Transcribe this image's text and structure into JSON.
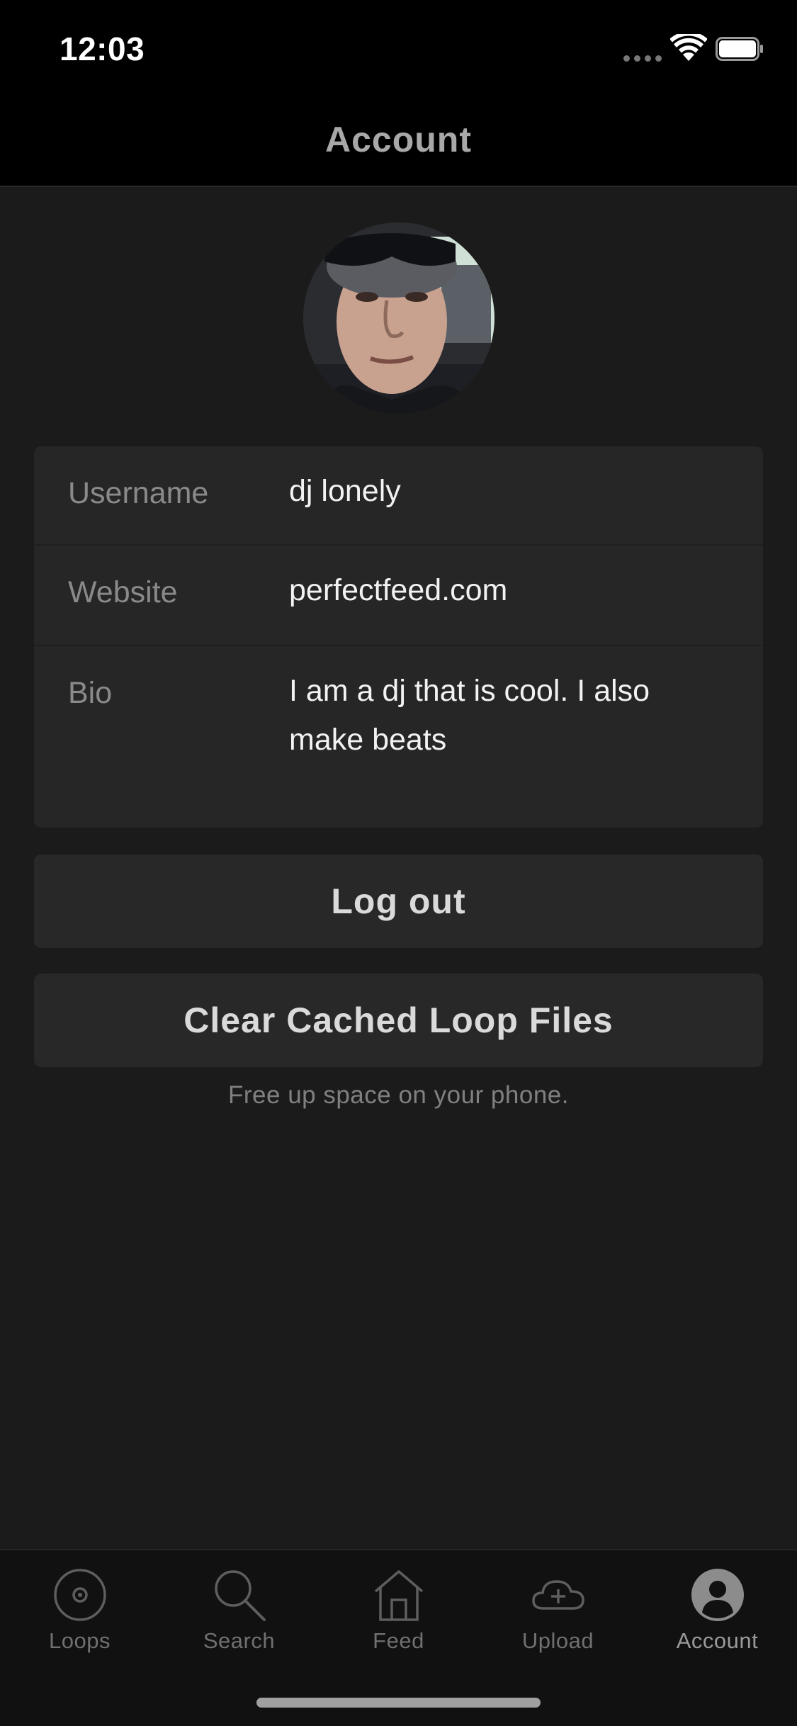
{
  "status_bar": {
    "time": "12:03"
  },
  "nav": {
    "title": "Account"
  },
  "profile": {
    "fields": [
      {
        "label": "Username",
        "value": "dj lonely"
      },
      {
        "label": "Website",
        "value": "perfectfeed.com"
      },
      {
        "label": "Bio",
        "value": "I am a dj that is cool. I also make beats"
      }
    ]
  },
  "actions": {
    "logout_label": "Log out",
    "clear_cache_label": "Clear Cached Loop Files",
    "clear_cache_hint": "Free up space on your phone."
  },
  "tabs": [
    {
      "label": "Loops",
      "icon": "loops-icon",
      "active": false
    },
    {
      "label": "Search",
      "icon": "search-icon",
      "active": false
    },
    {
      "label": "Feed",
      "icon": "home-icon",
      "active": false
    },
    {
      "label": "Upload",
      "icon": "cloud-upload-icon",
      "active": false
    },
    {
      "label": "Account",
      "icon": "account-icon",
      "active": true
    }
  ],
  "colors": {
    "background": "#1b1b1b",
    "bar": "#000000",
    "card": "#262626",
    "muted_text": "#8a8a8a"
  }
}
